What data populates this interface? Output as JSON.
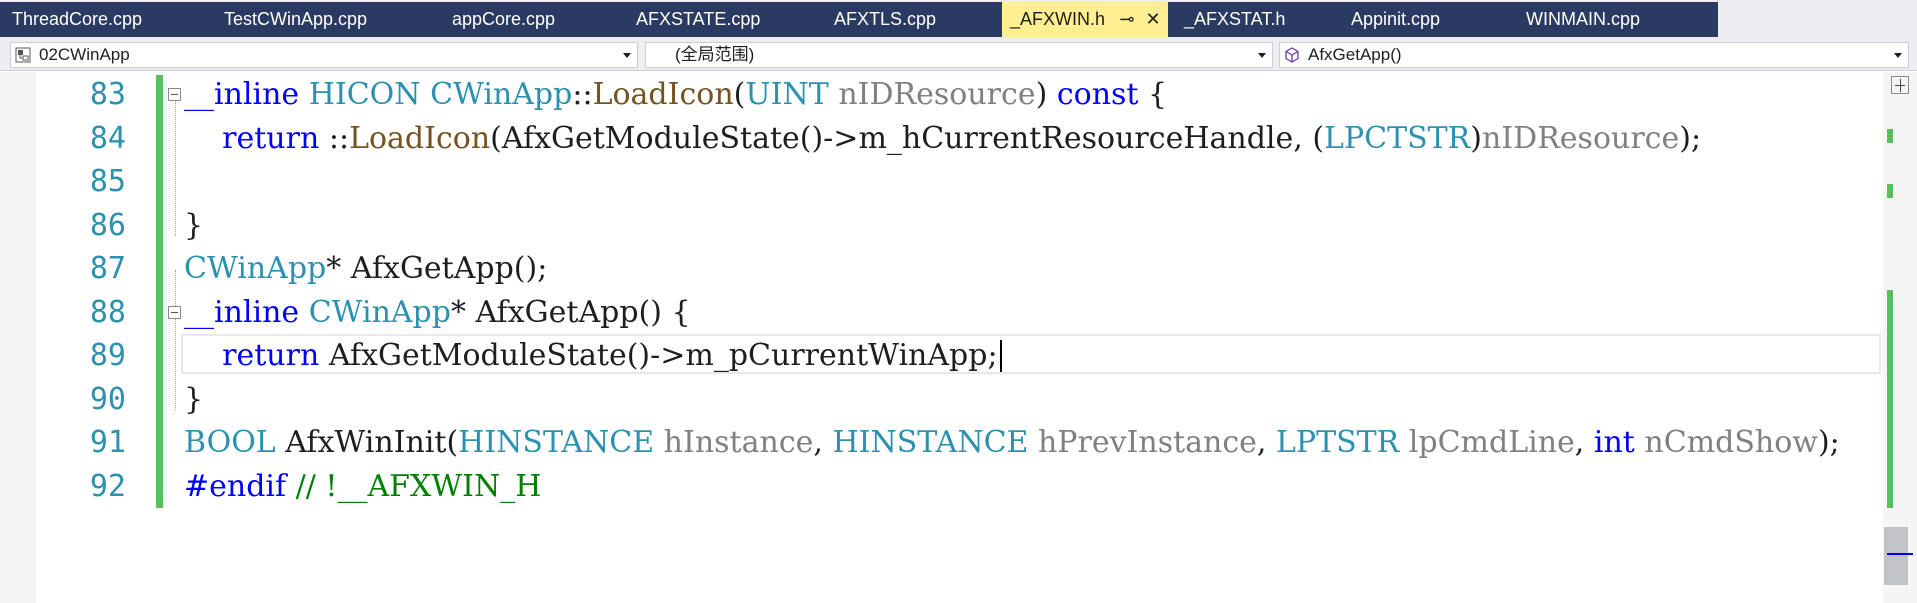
{
  "tabs": [
    {
      "label": "ThreadCore.cpp",
      "active": false
    },
    {
      "label": "TestCWinApp.cpp",
      "active": false
    },
    {
      "label": "appCore.cpp",
      "active": false
    },
    {
      "label": "AFXSTATE.cpp",
      "active": false
    },
    {
      "label": "AFXTLS.cpp",
      "active": false
    },
    {
      "label": "_AFXWIN.h",
      "active": true,
      "pin_glyph": "⊸",
      "close_glyph": "✕"
    },
    {
      "label": "_AFXSTAT.h",
      "active": false
    },
    {
      "label": "Appinit.cpp",
      "active": false
    },
    {
      "label": "WINMAIN.cpp",
      "active": false
    }
  ],
  "navigation": {
    "project": "02CWinApp",
    "project_icon": "project-icon",
    "scope": "(全局范围)",
    "member": "AfxGetApp()",
    "member_icon": "method-cube-icon"
  },
  "editor": {
    "lines": [
      {
        "number": "83",
        "fold": true,
        "tokens": [
          {
            "t": "__inline ",
            "c": "kw"
          },
          {
            "t": "HICON ",
            "c": "ty"
          },
          {
            "t": "CWinApp",
            "c": "ty"
          },
          {
            "t": "::",
            "c": "pl"
          },
          {
            "t": "LoadIcon",
            "c": "fn"
          },
          {
            "t": "(",
            "c": "pl"
          },
          {
            "t": "UINT ",
            "c": "ty"
          },
          {
            "t": "nIDResource",
            "c": "pa"
          },
          {
            "t": ") ",
            "c": "pl"
          },
          {
            "t": "const",
            "c": "kw"
          },
          {
            "t": " {",
            "c": "pl"
          }
        ]
      },
      {
        "number": "84",
        "fold": false,
        "tokens": [
          {
            "t": "    ",
            "c": "pl"
          },
          {
            "t": "return",
            "c": "kw"
          },
          {
            "t": " ::",
            "c": "pl"
          },
          {
            "t": "LoadIcon",
            "c": "fn"
          },
          {
            "t": "(AfxGetModuleState()->m_hCurrentResourceHandle, (",
            "c": "pl"
          },
          {
            "t": "LPCTSTR",
            "c": "ty"
          },
          {
            "t": ")",
            "c": "pl"
          },
          {
            "t": "nIDResource",
            "c": "pa"
          },
          {
            "t": ");",
            "c": "pl"
          }
        ]
      },
      {
        "number": "85",
        "fold": false,
        "tokens": []
      },
      {
        "number": "86",
        "fold": false,
        "tokens": [
          {
            "t": "}",
            "c": "pl"
          }
        ]
      },
      {
        "number": "87",
        "fold": false,
        "tokens": [
          {
            "t": "CWinApp",
            "c": "ty"
          },
          {
            "t": "* AfxGetApp();",
            "c": "pl"
          }
        ]
      },
      {
        "number": "88",
        "fold": true,
        "tokens": [
          {
            "t": "__inline ",
            "c": "kw"
          },
          {
            "t": "CWinApp",
            "c": "ty"
          },
          {
            "t": "* AfxGetApp() {",
            "c": "pl"
          }
        ]
      },
      {
        "number": "89",
        "fold": false,
        "current": true,
        "tokens": [
          {
            "t": "    ",
            "c": "pl"
          },
          {
            "t": "return",
            "c": "kw"
          },
          {
            "t": " AfxGetModuleState()->m_pCurrentWinApp;",
            "c": "pl"
          }
        ]
      },
      {
        "number": "90",
        "fold": false,
        "tokens": [
          {
            "t": "}",
            "c": "pl"
          }
        ]
      },
      {
        "number": "91",
        "fold": false,
        "tokens": [
          {
            "t": "BOOL ",
            "c": "ty"
          },
          {
            "t": "AfxWinInit(",
            "c": "pl"
          },
          {
            "t": "HINSTANCE ",
            "c": "ty"
          },
          {
            "t": "hInstance",
            "c": "pa"
          },
          {
            "t": ", ",
            "c": "pl"
          },
          {
            "t": "HINSTANCE ",
            "c": "ty"
          },
          {
            "t": "hPrevInstance",
            "c": "pa"
          },
          {
            "t": ", ",
            "c": "pl"
          },
          {
            "t": "LPTSTR ",
            "c": "ty"
          },
          {
            "t": "lpCmdLine",
            "c": "pa"
          },
          {
            "t": ", ",
            "c": "pl"
          },
          {
            "t": "int ",
            "c": "kw"
          },
          {
            "t": "nCmdShow",
            "c": "pa"
          },
          {
            "t": ");",
            "c": "pl"
          }
        ]
      },
      {
        "number": "92",
        "fold": false,
        "tokens": [
          {
            "t": "#endif",
            "c": "pp"
          },
          {
            "t": " // !__AFXWIN_H",
            "c": "cm"
          }
        ]
      }
    ]
  },
  "colors": {
    "tab_strip": "#2b3a62",
    "active_tab": "#ffef91",
    "keyword": "#0000ff",
    "type": "#2b91af",
    "function": "#74531f",
    "parameter": "#808080",
    "comment": "#008000",
    "saved_change_marker": "#57c05a"
  }
}
